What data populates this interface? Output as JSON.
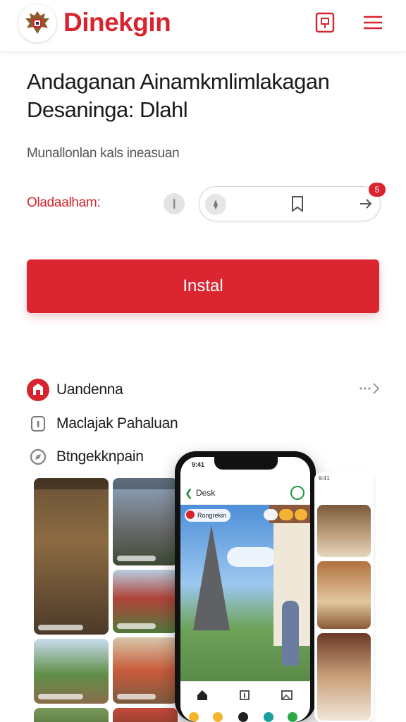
{
  "header": {
    "brand": "Dinekgin",
    "logo_icon": "garuda-emblem-icon",
    "right_icons": [
      "book-icon",
      "menu-icon"
    ],
    "accent_color": "#d8242f"
  },
  "main": {
    "title_line1": "Andaganan Ainamkmlimlakagan",
    "title_line2": "Desaninga: Dlahl",
    "subtitle": "Munallonlan kals ineasuan",
    "field_label": "Oladaalham:",
    "search_badge": "5",
    "install_label": "Instal"
  },
  "features": [
    {
      "label": "Uandenna",
      "icon": "store-icon"
    },
    {
      "label": "Maclajak Pahaluan",
      "icon": "info-icon"
    },
    {
      "label": "Btngekknpain",
      "icon": "compass-icon"
    }
  ],
  "phone": {
    "status_time": "9:41",
    "app_title": "Desk",
    "hero_chip": "Rongrekin",
    "side_time": "9:41"
  }
}
